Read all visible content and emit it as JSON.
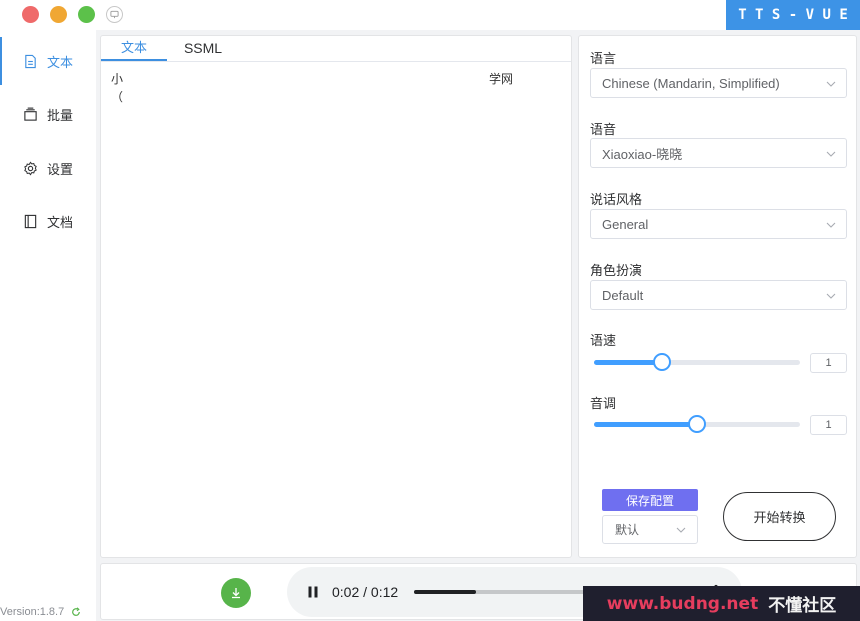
{
  "titlebar": {
    "brand": "T T S - V U E"
  },
  "sidebar": {
    "items": [
      {
        "label": "文本",
        "icon": "document-icon",
        "active": true
      },
      {
        "label": "批量",
        "icon": "batch-icon",
        "active": false
      },
      {
        "label": "设置",
        "icon": "gear-icon",
        "active": false
      },
      {
        "label": "文档",
        "icon": "book-icon",
        "active": false
      }
    ],
    "version": "Version:1.8.7"
  },
  "editor": {
    "tabs": [
      {
        "label": "文本"
      },
      {
        "label": "SSML"
      }
    ],
    "line1_left": "小",
    "line1_right": "学网",
    "line2": "（"
  },
  "settings": {
    "language_label": "语言",
    "language_value": "Chinese (Mandarin, Simplified)",
    "voice_label": "语音",
    "voice_value": "Xiaoxiao-晓晓",
    "style_label": "说话风格",
    "style_value": "General",
    "role_label": "角色扮演",
    "role_value": "Default",
    "rate_label": "语速",
    "rate_value": "1",
    "rate_fraction": 0.33,
    "pitch_label": "音调",
    "pitch_value": "1",
    "pitch_fraction": 0.5,
    "save_label": "保存配置",
    "preset_value": "默认",
    "start_label": "开始转换"
  },
  "player": {
    "time": "0:02 / 0:12",
    "progress_fraction": 0.26
  },
  "watermark": {
    "part1": "www.budng.net",
    "part2": "不懂社区"
  },
  "colors": {
    "accent": "#3d8fe0",
    "brand": "#3d93e6",
    "slider": "#409eff",
    "save": "#6f6ff0",
    "download": "#57b44a"
  }
}
